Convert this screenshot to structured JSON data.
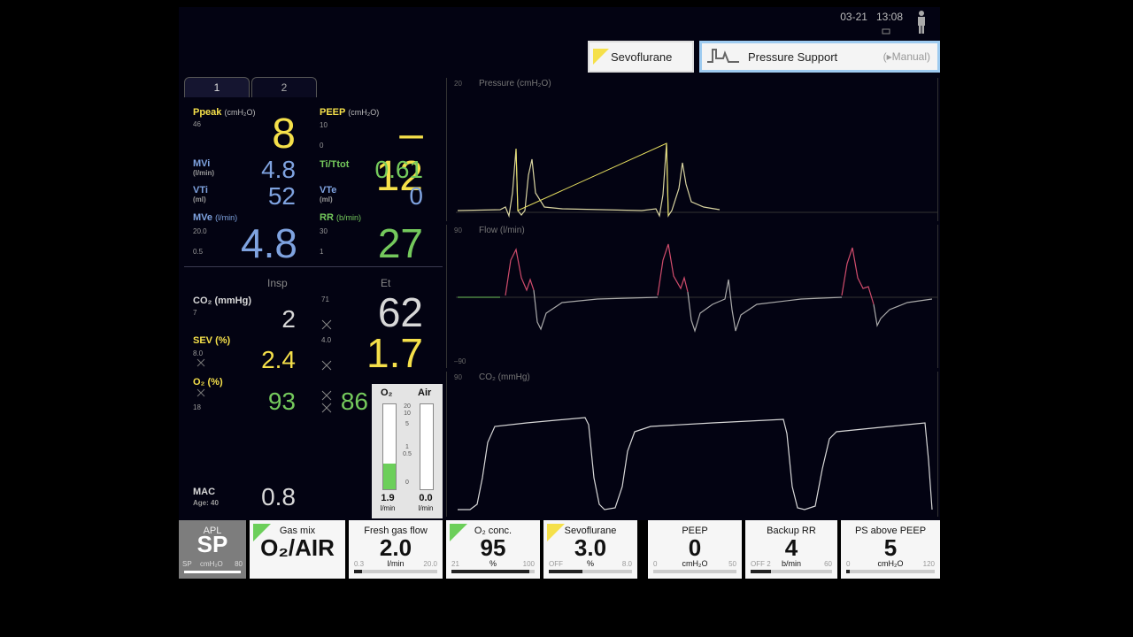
{
  "status": {
    "date": "03-21",
    "time": "13:08"
  },
  "header": {
    "agent_label": "Sevoflurane",
    "mode_label": "Pressure Support",
    "mode_sub": "(▸Manual)"
  },
  "tabs": [
    "1",
    "2"
  ],
  "params": {
    "ppeak": {
      "label": "Ppeak",
      "unit": "(cmH₂O)",
      "lim_hi": "46",
      "value": "8"
    },
    "peep": {
      "label": "PEEP",
      "unit": "(cmH₂O)",
      "lim_hi": "10",
      "lim_lo": "0",
      "value": "–12"
    },
    "mvi": {
      "label": "MVi",
      "unit": "(l/min)",
      "value": "4.8"
    },
    "ti_ttot": {
      "label": "Ti/Ttot",
      "value": "0.61"
    },
    "vti": {
      "label": "VTi",
      "unit": "(ml)",
      "value": "52"
    },
    "vte": {
      "label": "VTe",
      "unit": "(ml)",
      "value": "0"
    },
    "mve": {
      "label": "MVe",
      "unit": "(l/min)",
      "lim_hi": "20.0",
      "lim_lo": "0.5",
      "value": "4.8"
    },
    "rr": {
      "label": "RR",
      "unit": "(b/min)",
      "lim_hi": "30",
      "lim_lo": "1",
      "value": "27"
    }
  },
  "gas": {
    "insp_label": "Insp",
    "et_label": "Et",
    "co2": {
      "label": "CO₂ (mmHg)",
      "lim": "7",
      "et_lim": "71",
      "insp": "2",
      "et": "62"
    },
    "sev": {
      "label": "SEV (%)",
      "lim": "8.0",
      "et_lim": "4.0",
      "insp": "2.4",
      "et": "1.7"
    },
    "o2": {
      "label": "O₂ (%)",
      "lim": "18",
      "insp": "93",
      "et": "86"
    },
    "mac": {
      "label": "MAC",
      "age": "Age: 40",
      "value": "0.8"
    }
  },
  "flowmeter": {
    "o2_label": "O₂",
    "air_label": "Air",
    "scale": [
      "20",
      "10",
      "5",
      "1",
      "0.5",
      "0"
    ],
    "o2_value": "1.9",
    "air_value": "0.0",
    "unit": "l/min",
    "o2_fill": 0.3,
    "air_fill": 0.0
  },
  "waves": {
    "pressure": {
      "title": "Pressure (cmH₂O)",
      "top": "20"
    },
    "flow": {
      "title": "Flow (l/min)",
      "top": "90",
      "bottom": "–90"
    },
    "co2": {
      "title": "CO₂ (mmHg)",
      "top": "90"
    }
  },
  "bottom": {
    "apl": {
      "title": "APL",
      "value": "SP",
      "lo": "SP",
      "unit": "cmH₂O",
      "hi": "80"
    },
    "gas_mix": {
      "title": "Gas mix",
      "value": "O₂/AIR"
    },
    "fresh_gas": {
      "title": "Fresh gas flow",
      "value": "2.0",
      "unit": "l/min",
      "lo": "0.3",
      "hi": "20.0",
      "level": 0.1
    },
    "o2_conc": {
      "title": "O₂ conc.",
      "value": "95",
      "unit": "%",
      "lo": "21",
      "hi": "100",
      "level": 0.94
    },
    "sevo": {
      "title": "Sevoflurane",
      "value": "3.0",
      "unit": "%",
      "lo": "OFF",
      "hi": "8.0",
      "level": 0.4
    },
    "peep": {
      "title": "PEEP",
      "value": "0",
      "unit": "cmH₂O",
      "lo": "0",
      "hi": "50",
      "level": 0.0
    },
    "backup_rr": {
      "title": "Backup RR",
      "value": "4",
      "unit": "b/min",
      "lo": "OFF  2",
      "hi": "60",
      "level": 0.25
    },
    "ps_peep": {
      "title": "PS above PEEP",
      "value": "5",
      "unit": "cmH₂O",
      "lo": "0",
      "hi": "120",
      "level": 0.04
    }
  },
  "colors": {
    "yellow": "#f5e04a",
    "blue": "#7fa3e0",
    "green": "#74c95c",
    "grey": "#d8d8d8"
  }
}
